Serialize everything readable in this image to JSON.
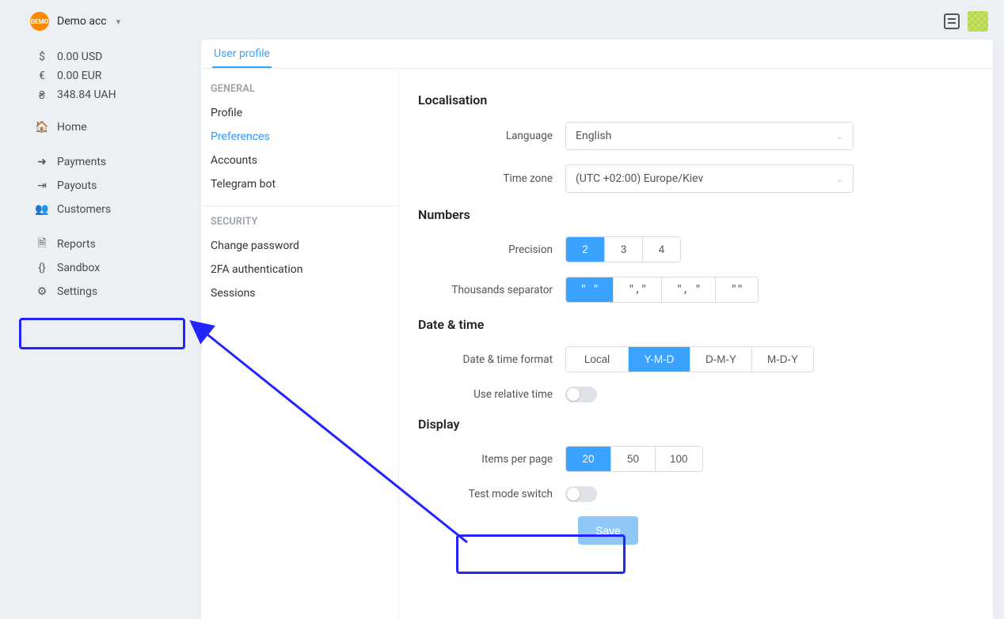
{
  "account": {
    "name": "Demo acc"
  },
  "balances": [
    {
      "icon": "$",
      "text": "0.00 USD"
    },
    {
      "icon": "€",
      "text": "0.00 EUR"
    },
    {
      "icon": "₴",
      "text": "348.84 UAH"
    }
  ],
  "nav": {
    "home": "Home",
    "payments": "Payments",
    "payouts": "Payouts",
    "customers": "Customers",
    "reports": "Reports",
    "sandbox": "Sandbox",
    "settings": "Settings"
  },
  "panel": {
    "tab": "User profile",
    "groups": {
      "general": {
        "title": "GENERAL",
        "items": {
          "profile": "Profile",
          "preferences": "Preferences",
          "accounts": "Accounts",
          "telegram": "Telegram bot"
        },
        "active": "preferences"
      },
      "security": {
        "title": "SECURITY",
        "items": {
          "change_pw": "Change password",
          "twofa": "2FA authentication",
          "sessions": "Sessions"
        }
      }
    }
  },
  "form": {
    "localisation": {
      "title": "Localisation",
      "language_label": "Language",
      "language_value": "English",
      "timezone_label": "Time zone",
      "timezone_value": "(UTC +02:00) Europe/Kiev"
    },
    "numbers": {
      "title": "Numbers",
      "precision_label": "Precision",
      "precision_options": [
        "2",
        "3",
        "4"
      ],
      "precision_selected": "2",
      "thousands_label": "Thousands separator",
      "thousands_options": [
        "\" \"",
        "\",\"",
        "\", \"",
        "\"\""
      ],
      "thousands_selected": "\" \""
    },
    "datetime": {
      "title": "Date & time",
      "format_label": "Date & time format",
      "format_options": [
        "Local",
        "Y-M-D",
        "D-M-Y",
        "M-D-Y"
      ],
      "format_selected": "Y-M-D",
      "relative_label": "Use relative time"
    },
    "display": {
      "title": "Display",
      "items_label": "Items per page",
      "items_options": [
        "20",
        "50",
        "100"
      ],
      "items_selected": "20",
      "testmode_label": "Test mode switch"
    },
    "save": "Save"
  }
}
